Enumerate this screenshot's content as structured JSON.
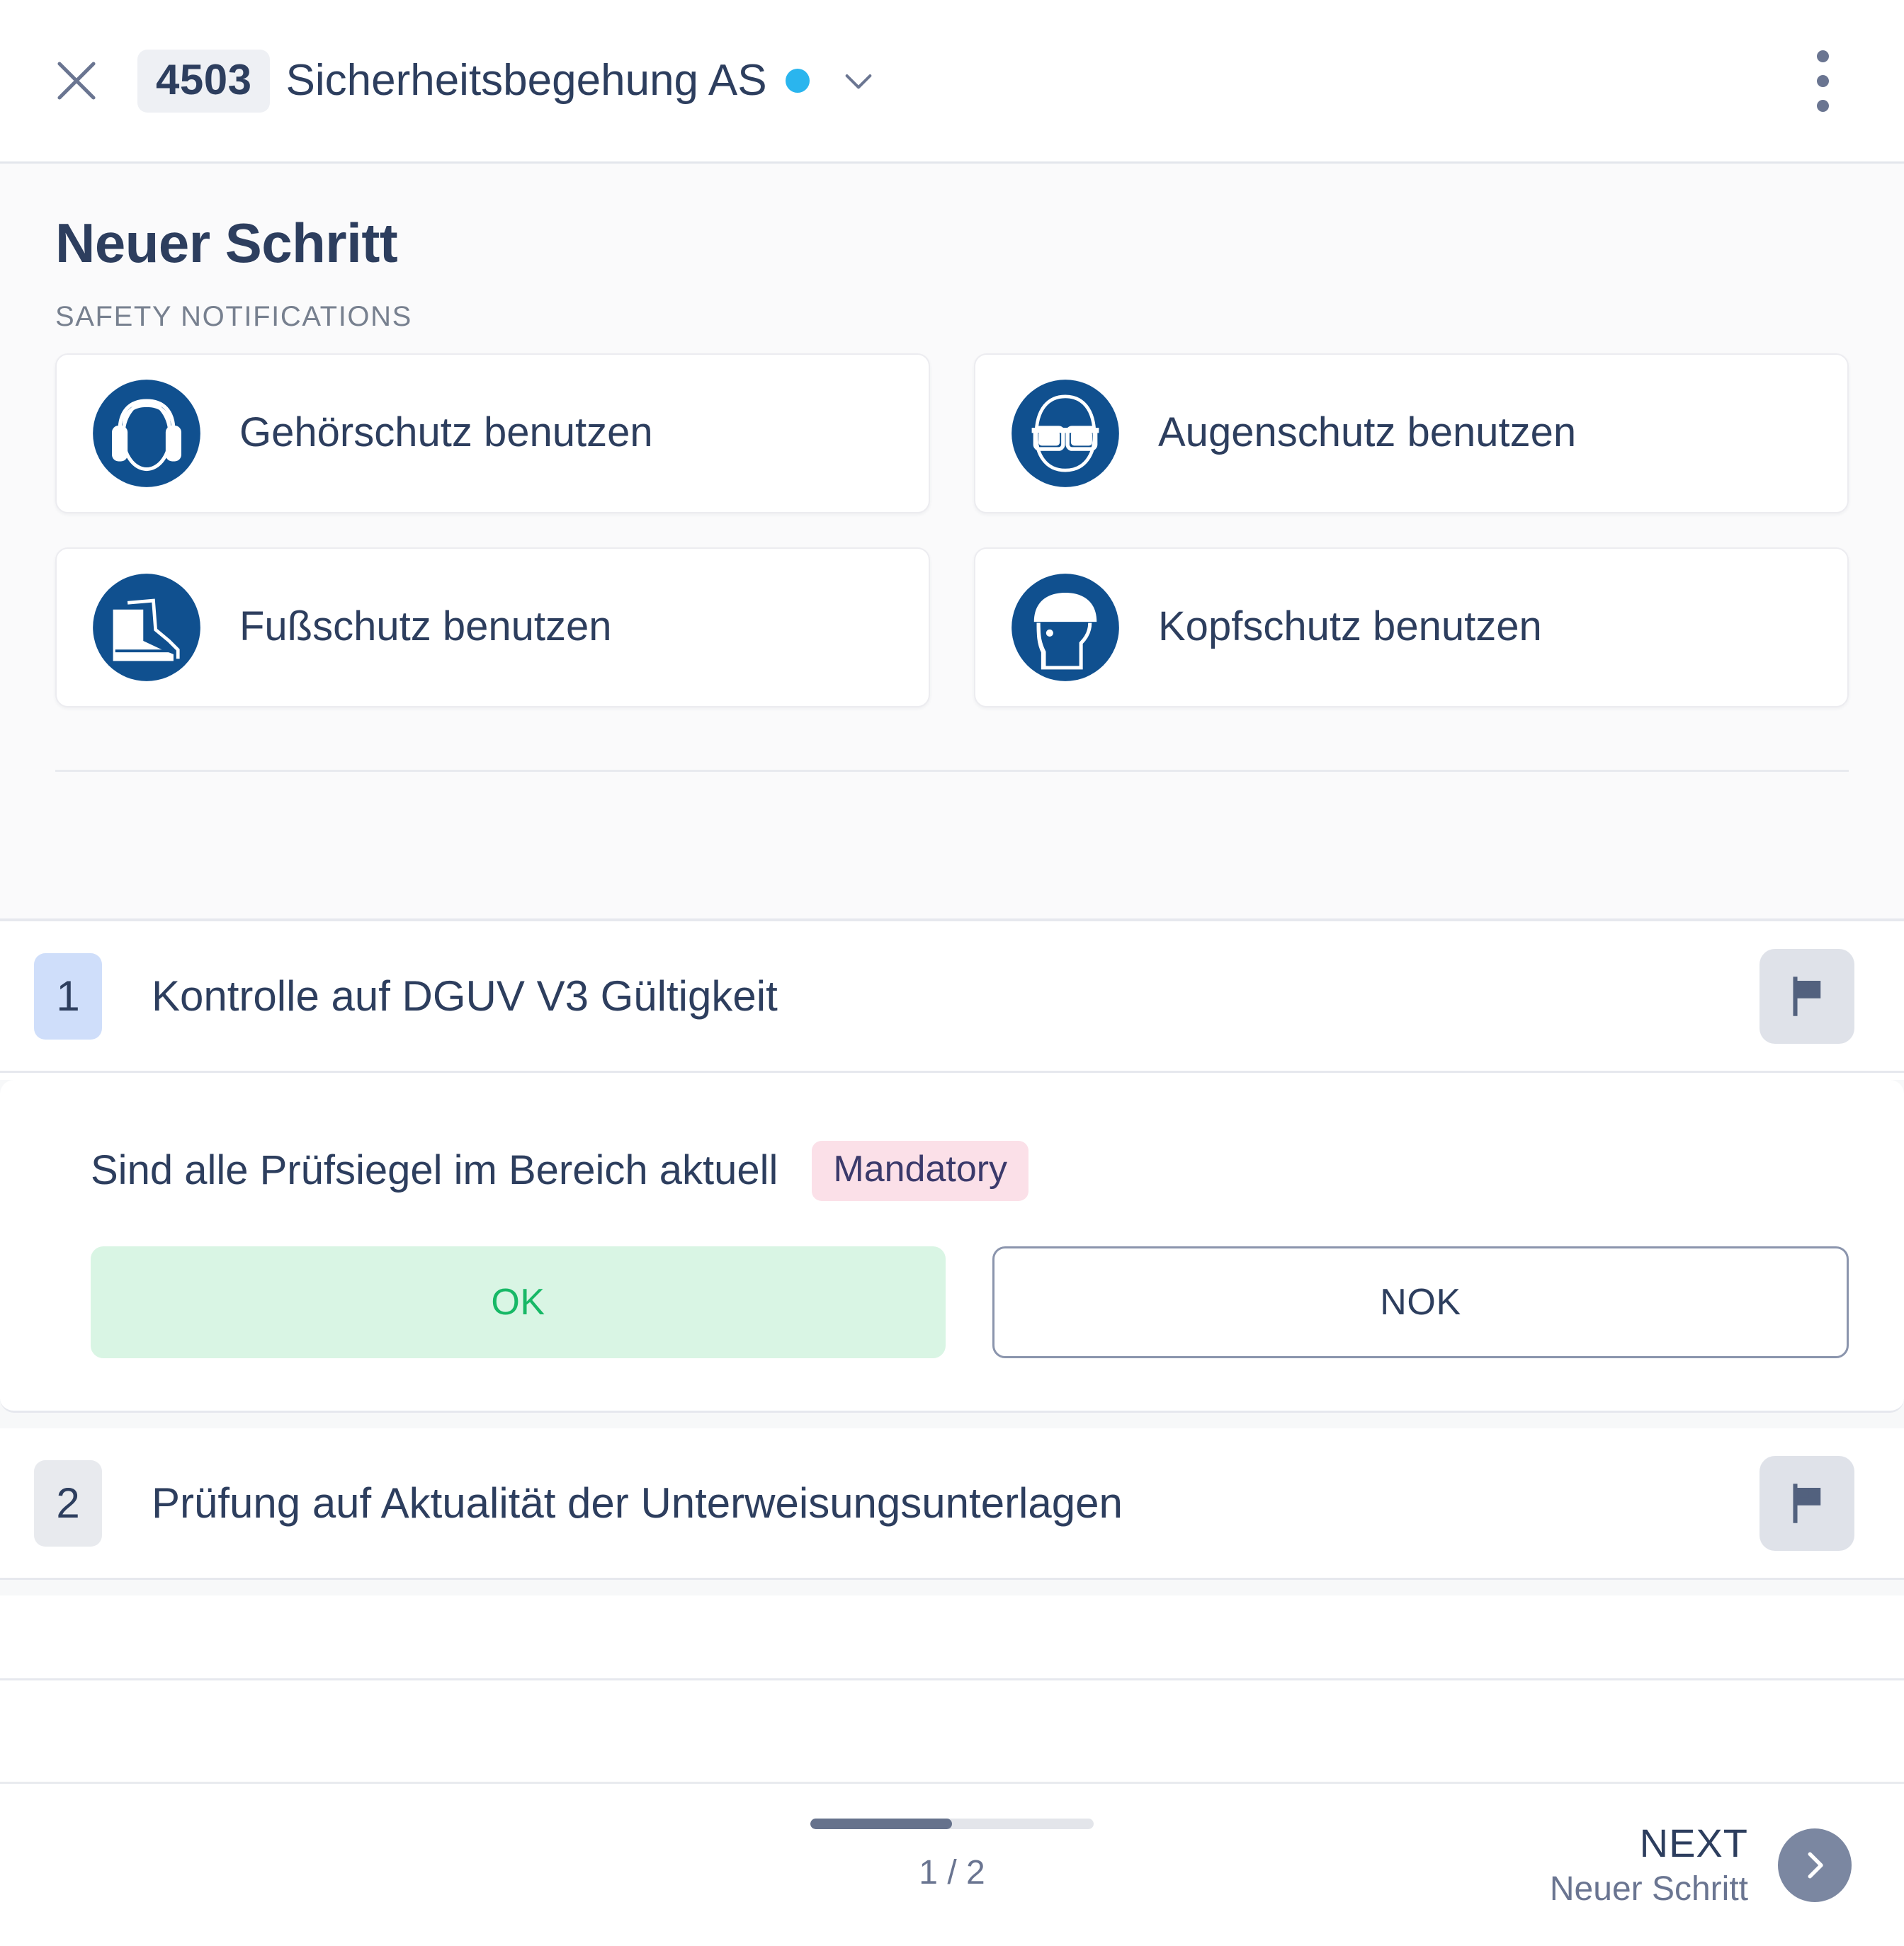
{
  "topbar": {
    "close_icon": "close-icon",
    "doc_number": "4503",
    "doc_title": "Sicherheitsbegehung AS",
    "status_dot_color": "#2ab5ee",
    "chevron_icon": "chevron-down-icon",
    "menu_icon": "kebab-menu-icon"
  },
  "header": {
    "page_title": "Neuer Schritt",
    "section_caption": "SAFETY NOTIFICATIONS",
    "safety_notifications": [
      {
        "label": "Gehörschutz benutzen",
        "icon": "ear-protection-icon"
      },
      {
        "label": "Augenschutz benutzen",
        "icon": "eye-protection-icon"
      },
      {
        "label": "Fußschutz benutzen",
        "icon": "foot-protection-icon"
      },
      {
        "label": "Kopfschutz benutzen",
        "icon": "head-protection-icon"
      }
    ]
  },
  "steps": [
    {
      "number": "1",
      "title": "Kontrolle auf DGUV V3 Gültigkeit",
      "flag_icon": "flag-icon",
      "active": true
    },
    {
      "number": "2",
      "title": "Prüfung auf Aktualität der Unterweisungsunterlagen",
      "flag_icon": "flag-icon",
      "active": false
    }
  ],
  "question": {
    "text": "Sind alle Prüfsiegel im Bereich aktuell",
    "badge": "Mandatory",
    "options": [
      {
        "label": "OK",
        "state": "selected"
      },
      {
        "label": "NOK",
        "state": "unselected"
      }
    ]
  },
  "bottombar": {
    "progress_percent": 50,
    "progress_label": "1 / 2",
    "next_label": "NEXT",
    "next_sublabel": "Neuer Schritt",
    "next_icon": "chevron-right-icon"
  },
  "colors": {
    "brand_navy": "#2d3e5e",
    "safety_blue": "#10508f",
    "status_cyan": "#2ab5ee",
    "ok_green": "#17b866",
    "ok_green_bg": "#d9f5e4",
    "mandatory_bg": "#fbe0e8",
    "step_active_bg": "#cfdefa",
    "slate": "#6a7591"
  }
}
